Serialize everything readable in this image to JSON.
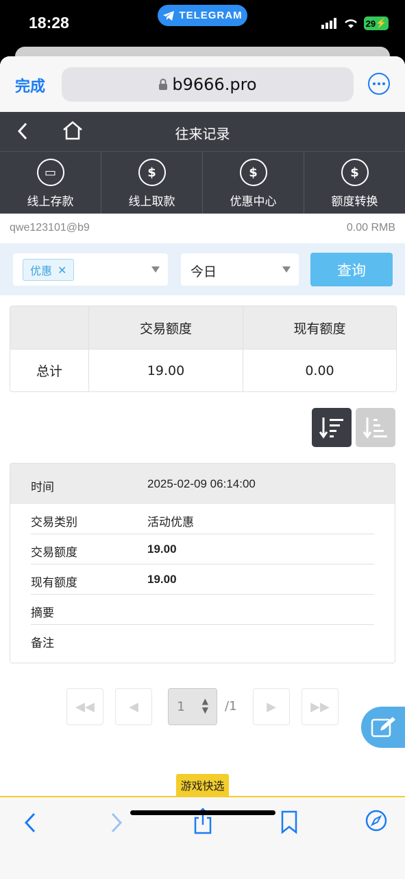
{
  "status": {
    "time": "18:28",
    "telegram_label": "TELEGRAM",
    "battery": "29"
  },
  "browser": {
    "done_label": "完成",
    "url": "b9666.pro"
  },
  "header": {
    "title": "往来记录"
  },
  "quick_menu": [
    {
      "label": "线上存款",
      "icon": "card-in-hand-icon"
    },
    {
      "label": "线上取款",
      "icon": "coin-in-hand-icon"
    },
    {
      "label": "优惠中心",
      "icon": "coin-cycle-icon"
    },
    {
      "label": "额度转换",
      "icon": "exchange-coins-icon"
    }
  ],
  "account": {
    "user": "qwe123101@b9",
    "balance": "0.00 RMB"
  },
  "filters": {
    "type_tag": "优惠",
    "date": "今日",
    "query_label": "查询"
  },
  "summary": {
    "headers": [
      "",
      "交易额度",
      "现有额度"
    ],
    "row": [
      "总计",
      "19.00",
      "0.00"
    ]
  },
  "record": {
    "time_label": "时间",
    "time_value": "2025-02-09 06:14:00",
    "rows": [
      {
        "label": "交易类别",
        "value": "活动优惠"
      },
      {
        "label": "交易额度",
        "value": "19.00"
      },
      {
        "label": "现有额度",
        "value": "19.00"
      },
      {
        "label": "摘要",
        "value": ""
      },
      {
        "label": "备注",
        "value": ""
      }
    ]
  },
  "pager": {
    "current": "1",
    "total": "/1"
  },
  "game_tab": "游戏快选"
}
